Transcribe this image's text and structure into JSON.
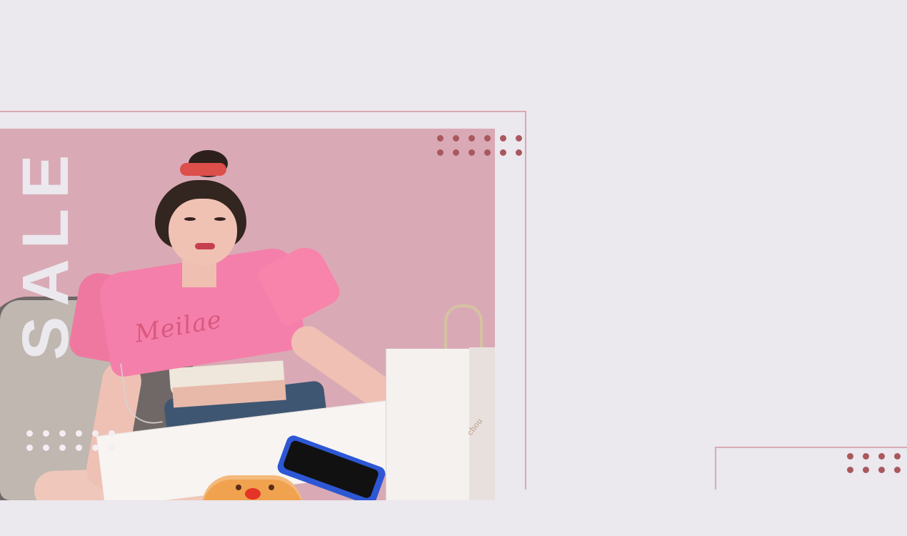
{
  "banner": {
    "sale_text": "SALE"
  },
  "colors": {
    "background": "#ebe8ee",
    "accent_pink": "#d8a9b3",
    "dot_brown": "#a9585d"
  },
  "icons": {
    "top_right_dots": "dot-grid-icon",
    "left_bottom_dots": "dot-grid-icon",
    "bottom_right_dots": "dot-grid-icon"
  }
}
